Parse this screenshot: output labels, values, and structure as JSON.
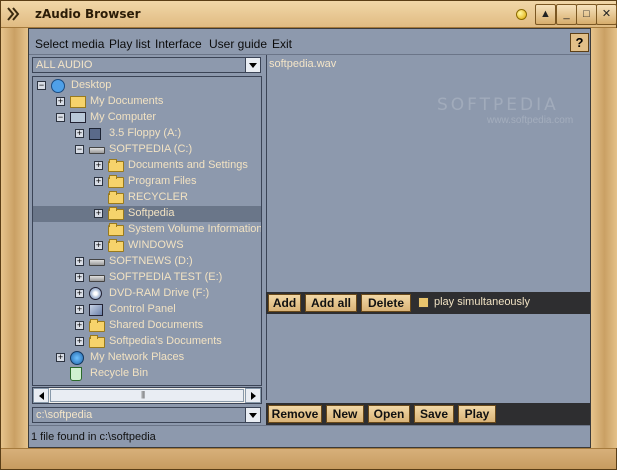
{
  "window": {
    "title": "zAudio Browser",
    "buttons": [
      "▲",
      "_",
      "□",
      "✕"
    ]
  },
  "menu": {
    "items": [
      {
        "label": "Select media"
      },
      {
        "label": "Play list"
      },
      {
        "label": "Interface"
      },
      {
        "label": "User guide"
      },
      {
        "label": "Exit"
      }
    ],
    "help": "?"
  },
  "filter": {
    "value": "ALL AUDIO"
  },
  "tree": [
    {
      "label": "Desktop",
      "level": 0,
      "expander": "−",
      "icon": "desktop-icon"
    },
    {
      "label": "My Documents",
      "level": 1,
      "expander": "+",
      "icon": "documents-icon"
    },
    {
      "label": "My Computer",
      "level": 1,
      "expander": "−",
      "icon": "computer-icon"
    },
    {
      "label": "3.5 Floppy (A:)",
      "level": 2,
      "expander": "+",
      "icon": "floppy-icon"
    },
    {
      "label": "SOFTPEDIA (C:)",
      "level": 2,
      "expander": "−",
      "icon": "drive-icon"
    },
    {
      "label": "Documents and Settings",
      "level": 3,
      "expander": "+",
      "icon": "folder-icon"
    },
    {
      "label": "Program Files",
      "level": 3,
      "expander": "+",
      "icon": "folder-icon"
    },
    {
      "label": "RECYCLER",
      "level": 3,
      "expander": "",
      "icon": "folder-icon"
    },
    {
      "label": "Softpedia",
      "level": 3,
      "expander": "+",
      "icon": "folder-icon",
      "selected": true
    },
    {
      "label": "System Volume Information",
      "level": 3,
      "expander": "",
      "icon": "folder-icon"
    },
    {
      "label": "WINDOWS",
      "level": 3,
      "expander": "+",
      "icon": "folder-icon"
    },
    {
      "label": "SOFTNEWS (D:)",
      "level": 2,
      "expander": "+",
      "icon": "drive-icon"
    },
    {
      "label": "SOFTPEDIA TEST (E:)",
      "level": 2,
      "expander": "+",
      "icon": "drive-icon"
    },
    {
      "label": "DVD-RAM Drive (F:)",
      "level": 2,
      "expander": "+",
      "icon": "dvd-icon"
    },
    {
      "label": "Control Panel",
      "level": 2,
      "expander": "+",
      "icon": "control-panel-icon"
    },
    {
      "label": "Shared Documents",
      "level": 2,
      "expander": "+",
      "icon": "folder-icon"
    },
    {
      "label": "Softpedia's Documents",
      "level": 2,
      "expander": "+",
      "icon": "folder-icon"
    },
    {
      "label": "My Network Places",
      "level": 1,
      "expander": "+",
      "icon": "network-icon"
    },
    {
      "label": "Recycle Bin",
      "level": 1,
      "expander": "",
      "icon": "recycle-bin-icon"
    }
  ],
  "path": {
    "value": "c:\\softpedia"
  },
  "status": "1 file found in c:\\softpedia",
  "files": [
    "softpedia.wav"
  ],
  "watermark": {
    "big": "SOFTPEDIA",
    "small": "www.softpedia.com"
  },
  "actions": {
    "add": "Add",
    "add_all": "Add all",
    "delete": "Delete",
    "simultaneous": "play simultaneously"
  },
  "playlist_actions": {
    "remove": "Remove",
    "new": "New",
    "open": "Open",
    "save": "Save",
    "play": "Play"
  }
}
